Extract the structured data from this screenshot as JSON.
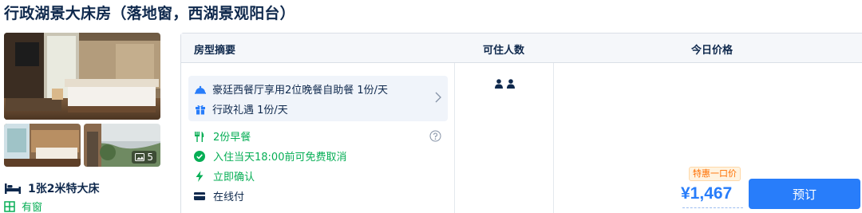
{
  "room": {
    "title": "行政湖景大床房（落地窗，西湖景观阳台）",
    "photo_count": "5",
    "bed": "1张2米特大床",
    "window": "有窗"
  },
  "table": {
    "headers": {
      "summary": "房型摘要",
      "occupancy": "可住人数",
      "price": "今日价格"
    },
    "benefits": [
      {
        "icon": "dining-bell-icon",
        "text": "豪廷西餐厅享用2位晚餐自助餐 1份/天"
      },
      {
        "icon": "gift-icon",
        "text": "行政礼遇 1份/天"
      }
    ],
    "features": [
      {
        "icon": "utensils-icon",
        "text": "2份早餐",
        "color": "#06ae55"
      },
      {
        "icon": "check-circle-icon",
        "text": "入住当天18:00前可免费取消",
        "color": "#06ae55"
      },
      {
        "icon": "lightning-icon",
        "text": "立即确认",
        "color": "#06ae55"
      },
      {
        "icon": "card-icon",
        "text": "在线付",
        "color": "#0f294d"
      }
    ],
    "guests": 2,
    "deal_badge": "特惠一口价",
    "price": "¥1,467",
    "book_label": "预订"
  },
  "colors": {
    "primary": "#287dfa",
    "green": "#06ae55",
    "text": "#0f294d",
    "orange": "#ff6f00"
  }
}
